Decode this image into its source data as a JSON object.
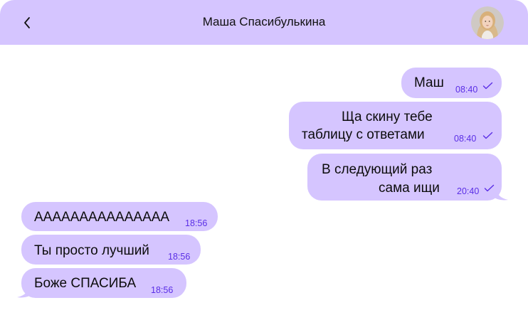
{
  "header": {
    "title": "Маша Спасибулькина",
    "back_icon": "chevron-left-icon",
    "avatar": "contact-avatar"
  },
  "colors": {
    "header_bg": "#d5c5ff",
    "bubble_bg": "#d5c5ff",
    "time_color": "#5a2ee6",
    "page_bg": "#ffffff"
  },
  "messages": {
    "outgoing": [
      {
        "lines": [
          "Маш"
        ],
        "time": "08:40",
        "status": "read-check-icon"
      },
      {
        "lines": [
          "Ща скину тебе",
          "таблицу с ответами"
        ],
        "time": "08:40",
        "status": "read-check-icon"
      },
      {
        "lines": [
          "В следующий раз",
          "сама ищи"
        ],
        "time": "20:40",
        "status": "read-check-icon"
      }
    ],
    "incoming": [
      {
        "lines": [
          "ААААААААААААААА"
        ],
        "time": "18:56"
      },
      {
        "lines": [
          "Ты просто лучший"
        ],
        "time": "18:56"
      },
      {
        "lines": [
          "Боже СПАСИБА"
        ],
        "time": "18:56"
      }
    ]
  }
}
